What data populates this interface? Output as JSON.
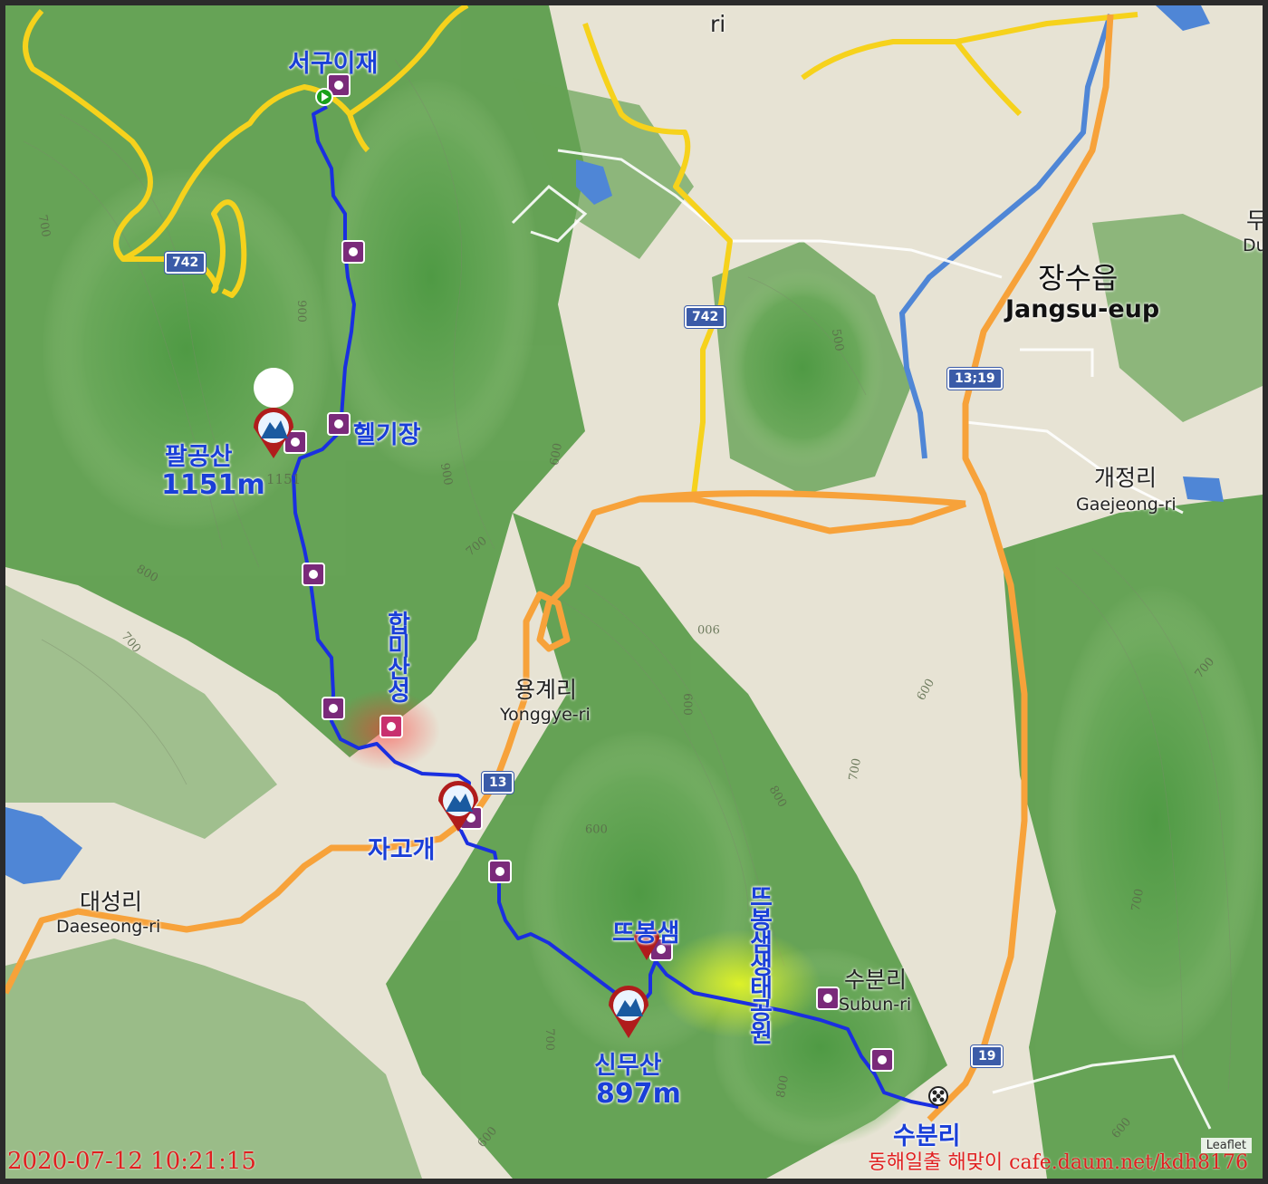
{
  "map": {
    "route_color": "#1a2fe0",
    "start_marker": "green-play-icon",
    "end_marker": "checkered-flag-icon",
    "camera_icon": "camera-icon"
  },
  "places": {
    "seogui": "서구이재",
    "helipad": "헬기장",
    "palgong_name": "팔공산",
    "palgong_elev": "1151m",
    "hammi": "합미산성",
    "jagogae": "자고개",
    "tteumbong": "뜨봉샘",
    "tteumbong_park": "뜨봉샘생태공원",
    "sinmu_name": "신무산",
    "sinmu_elev": "897m",
    "subun_end": "수분리"
  },
  "towns": {
    "ri_top": "ri",
    "jangsu_ko": "장수읍",
    "jangsu_en": "Jangsu-eup",
    "gaejeong_ko": "개정리",
    "gaejeong_en": "Gaejeong-ri",
    "yonggye_ko": "용계리",
    "yonggye_en": "Yonggye-ri",
    "daeseong_ko": "대성리",
    "daeseong_en": "Daeseong-ri",
    "subun_ko": "수분리",
    "subun_en": "Subun-ri",
    "du_ko": "두",
    "du_en": "Du"
  },
  "roads": {
    "r742_a": "742",
    "r742_b": "742",
    "r13_19": "13;19",
    "r13": "13",
    "r19": "19"
  },
  "contours": [
    "700",
    "900",
    "900",
    "800",
    "800",
    "700",
    "900",
    "1151",
    "600",
    "700",
    "500",
    "600",
    "900",
    "700",
    "800",
    "700",
    "600",
    "700",
    "800",
    "700",
    "009",
    "009",
    "600",
    "600",
    "700"
  ],
  "footer": {
    "timestamp": "2020-07-12 10:21:15",
    "credit": "동해일출 해맞이 cafe.daum.net/kdh8176",
    "leaflet": "Leaflet"
  }
}
